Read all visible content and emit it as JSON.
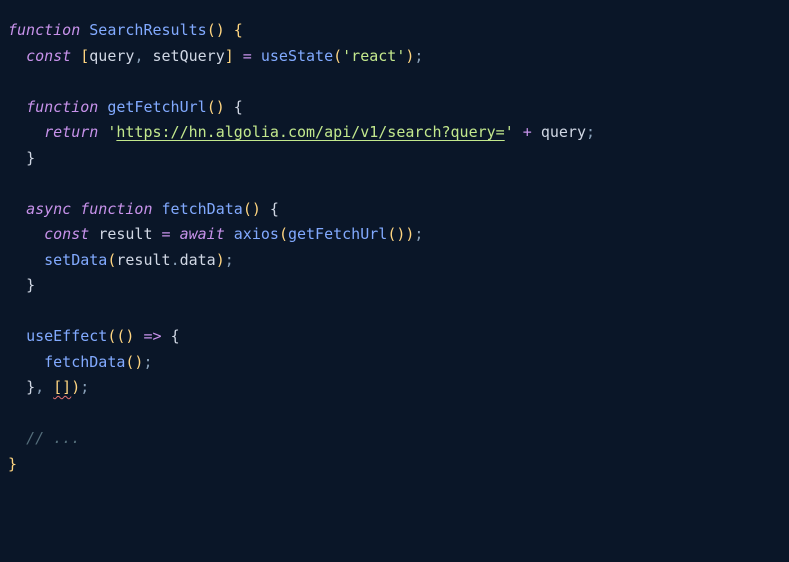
{
  "code": {
    "line1": {
      "function": "function",
      "name": "SearchResults",
      "parens": "()",
      "brace": " {"
    },
    "line2": {
      "indent": "  ",
      "const": "const",
      "space1": " ",
      "lbracket": "[",
      "query": "query",
      "comma": ", ",
      "setQuery": "setQuery",
      "rbracket": "]",
      "eq": " = ",
      "useState": "useState",
      "lparen": "(",
      "str": "'react'",
      "rparen": ")",
      "semi": ";"
    },
    "line4": {
      "indent": "  ",
      "function": "function",
      "space": " ",
      "name": "getFetchUrl",
      "parens": "()",
      "brace": " {"
    },
    "line5": {
      "indent": "    ",
      "return": "return",
      "space": " ",
      "str_q1": "'",
      "str_url": "https://hn.algolia.com/api/v1/search?query=",
      "str_q2": "'",
      "plus": " + ",
      "query": "query",
      "semi": ";"
    },
    "line6": {
      "indent": "  ",
      "brace": "}"
    },
    "line8": {
      "indent": "  ",
      "async": "async",
      "space1": " ",
      "function": "function",
      "space2": " ",
      "name": "fetchData",
      "parens": "()",
      "brace": " {"
    },
    "line9": {
      "indent": "    ",
      "const": "const",
      "space1": " ",
      "result": "result",
      "eq": " = ",
      "await": "await",
      "space2": " ",
      "axios": "axios",
      "lparen": "(",
      "getFetchUrl": "getFetchUrl",
      "innerparens": "()",
      "rparen": ")",
      "semi": ";"
    },
    "line10": {
      "indent": "    ",
      "setData": "setData",
      "lparen": "(",
      "result": "result",
      "dot": ".",
      "data": "data",
      "rparen": ")",
      "semi": ";"
    },
    "line11": {
      "indent": "  ",
      "brace": "}"
    },
    "line13": {
      "indent": "  ",
      "useEffect": "useEffect",
      "lparen": "(",
      "innerparens": "()",
      "arrow": " => ",
      "brace": "{"
    },
    "line14": {
      "indent": "    ",
      "fetchData": "fetchData",
      "parens": "()",
      "semi": ";"
    },
    "line15": {
      "indent": "  ",
      "brace": "}",
      "comma": ", ",
      "brackets": "[]",
      "rparen": ")",
      "semi": ";"
    },
    "line17": {
      "indent": "  ",
      "comment": "// ..."
    },
    "line18": {
      "brace": "}"
    }
  }
}
